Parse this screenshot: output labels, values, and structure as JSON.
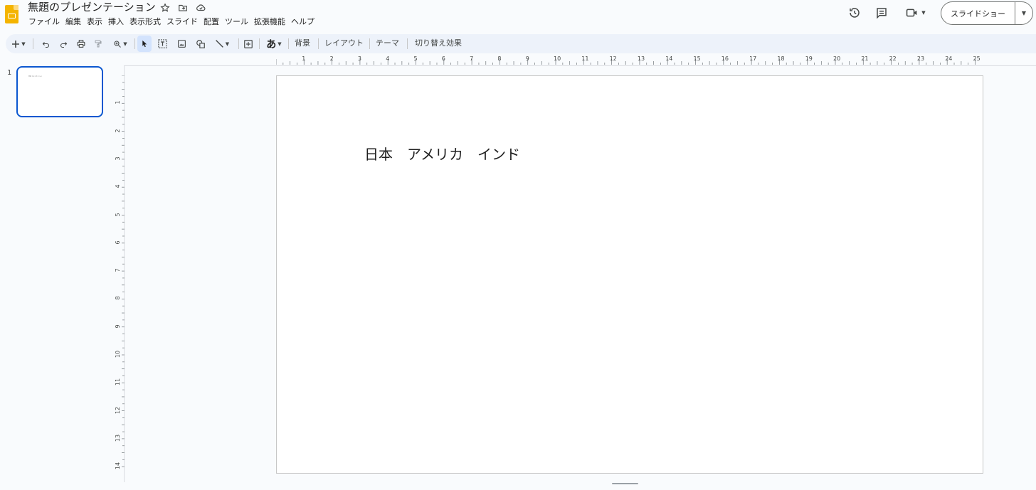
{
  "document": {
    "title": "無題のプレゼンテーション"
  },
  "menu": {
    "items": [
      "ファイル",
      "編集",
      "表示",
      "挿入",
      "表示形式",
      "スライド",
      "配置",
      "ツール",
      "拡張機能",
      "ヘルプ"
    ]
  },
  "header_actions": {
    "slideshow_label": "スライドショー"
  },
  "toolbar": {
    "background_label": "背景",
    "layout_label": "レイアウト",
    "theme_label": "テーマ",
    "transition_label": "切り替え効果",
    "text_style_glyph": "あ"
  },
  "filmstrip": {
    "slides": [
      {
        "number": "1",
        "thumb_text": "日本 アメリカ インド"
      }
    ]
  },
  "rulers": {
    "horizontal": [
      "1",
      "2",
      "3",
      "4",
      "5",
      "6",
      "7",
      "8",
      "9",
      "10",
      "11",
      "12",
      "13",
      "14",
      "15",
      "16",
      "17",
      "18",
      "19",
      "20",
      "21",
      "22",
      "23",
      "24",
      "25"
    ],
    "vertical": [
      "1",
      "2",
      "3",
      "4",
      "5",
      "6",
      "7",
      "8",
      "9",
      "10",
      "11",
      "12",
      "13",
      "14"
    ]
  },
  "slide": {
    "text": "日本　アメリカ　インド"
  },
  "colors": {
    "accent": "#0b57d0",
    "toolbar_bg": "#edf2fa",
    "logo": "#f4b400",
    "selected_tool_bg": "#d3e3fd"
  }
}
